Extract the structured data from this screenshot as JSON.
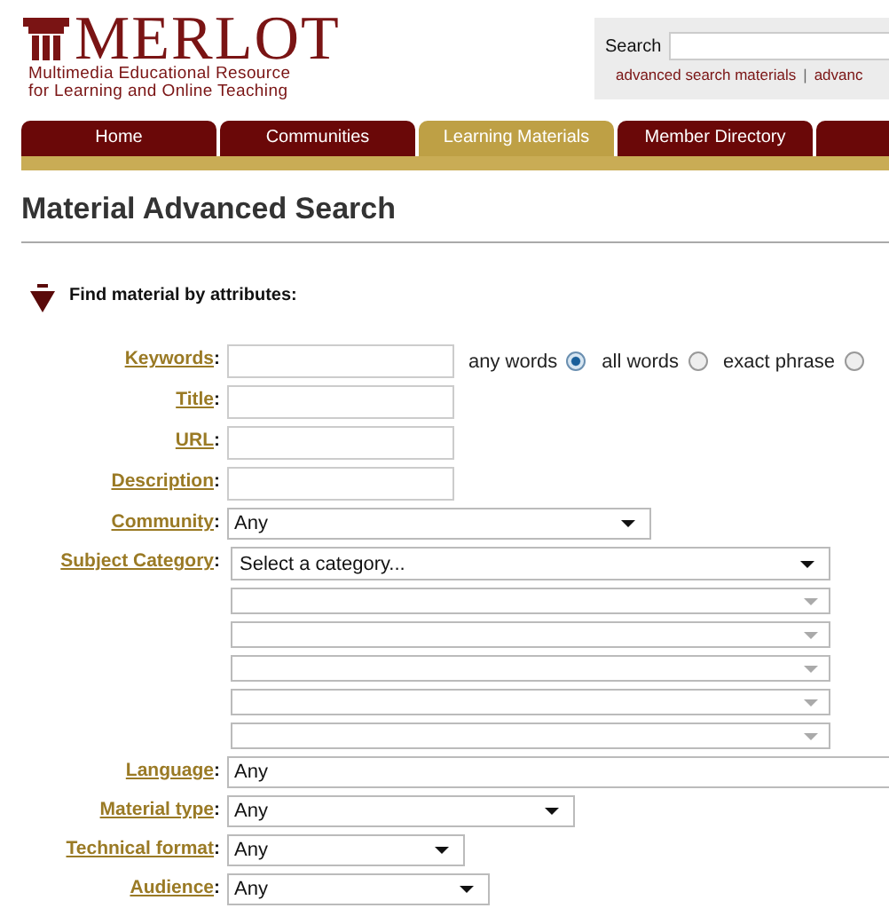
{
  "header": {
    "logo": "MERLOT",
    "tagline": [
      "Multimedia Educational Resource",
      "for Learning and Online Teaching"
    ]
  },
  "search": {
    "label": "Search",
    "links": [
      "advanced search materials",
      "advanc"
    ],
    "separator": "|"
  },
  "tabs": [
    {
      "label": "Home",
      "selected": false
    },
    {
      "label": "Communities",
      "selected": false
    },
    {
      "label": "Learning Materials",
      "selected": true
    },
    {
      "label": "Member Directory",
      "selected": false
    },
    {
      "selected": false
    }
  ],
  "page_title": "Material Advanced Search",
  "section": {
    "title": "Find material by attributes:",
    "expanded": true
  },
  "fields": [
    {
      "label": "Keywords",
      "colon": ":",
      "kind": "text"
    },
    {
      "label": "Title",
      "colon": ":",
      "kind": "text"
    },
    {
      "label": "URL",
      "colon": ":",
      "kind": "text"
    },
    {
      "label": "Description",
      "colon": ":",
      "kind": "text"
    },
    {
      "label": "Community",
      "colon": ":",
      "kind": "select",
      "value": "Any"
    },
    {
      "label": "Subject Category",
      "colon": ":",
      "kind": "category",
      "value": "Select a category...",
      "subcategories": [
        {
          "disabled": true
        },
        {
          "disabled": true
        },
        {
          "disabled": true
        },
        {
          "disabled": true
        },
        {
          "disabled": true
        }
      ]
    },
    {
      "label": "Language",
      "colon": ":",
      "kind": "select",
      "value": "Any"
    },
    {
      "label": "Material type",
      "colon": ":",
      "kind": "select",
      "value": "Any"
    },
    {
      "label": "Technical format",
      "colon": ":",
      "kind": "select",
      "value": "Any"
    },
    {
      "label": "Audience",
      "colon": ":",
      "kind": "select",
      "value": "Any"
    }
  ],
  "keyword_modes": [
    {
      "label": "any words",
      "selected": true
    },
    {
      "label": "all words",
      "selected": false
    },
    {
      "label": "exact phrase",
      "selected": false
    }
  ]
}
